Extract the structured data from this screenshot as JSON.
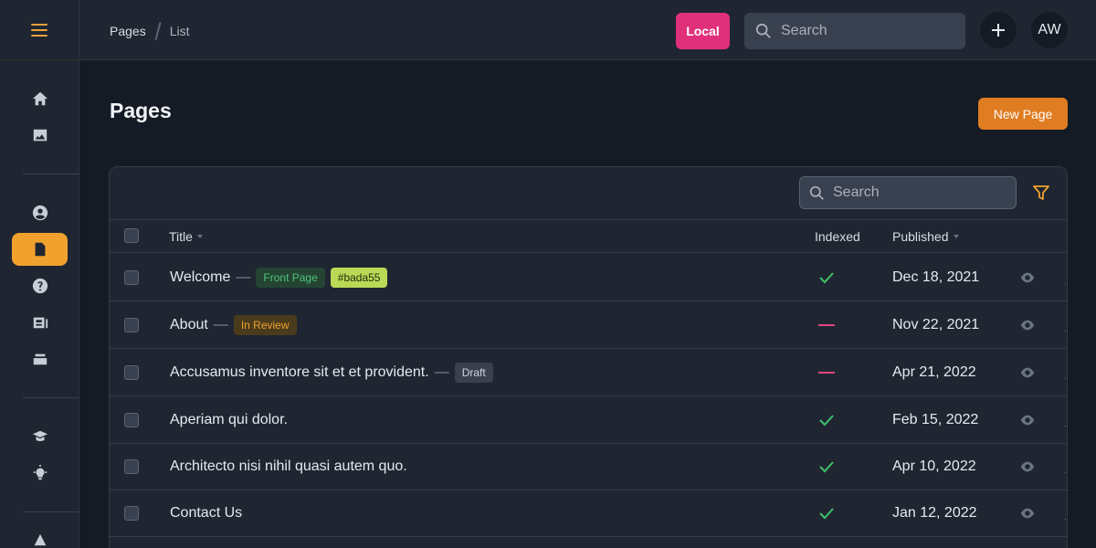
{
  "topbar": {
    "breadcrumb": [
      "Pages",
      "List"
    ],
    "env_badge": "Local",
    "search_placeholder": "Search",
    "avatar_initials": "AW"
  },
  "page": {
    "title": "Pages",
    "new_button": "New Page"
  },
  "table": {
    "search_placeholder": "Search",
    "columns": {
      "title": "Title",
      "indexed": "Indexed",
      "published": "Published"
    },
    "rows": [
      {
        "title": "Welcome",
        "tags": [
          {
            "label": "Front Page",
            "style": "green"
          },
          {
            "label": "#bada55",
            "style": "lime"
          }
        ],
        "indexed": true,
        "published": "Dec 18, 2021"
      },
      {
        "title": "About",
        "tags": [
          {
            "label": "In Review",
            "style": "amber"
          }
        ],
        "indexed": false,
        "published": "Nov 22, 2021"
      },
      {
        "title": "Accusamus inventore sit et et provident.",
        "tags": [
          {
            "label": "Draft",
            "style": "gray"
          }
        ],
        "indexed": false,
        "published": "Apr 21, 2022"
      },
      {
        "title": "Aperiam qui dolor.",
        "tags": [],
        "indexed": true,
        "published": "Feb 15, 2022"
      },
      {
        "title": "Architecto nisi nihil quasi autem quo.",
        "tags": [],
        "indexed": true,
        "published": "Apr 10, 2022"
      },
      {
        "title": "Contact Us",
        "tags": [],
        "indexed": true,
        "published": "Jan 12, 2022"
      }
    ]
  },
  "sidebar": {
    "items": [
      {
        "name": "home-icon"
      },
      {
        "name": "image-icon"
      },
      {
        "name": "user-circle-icon"
      },
      {
        "name": "document-icon",
        "active": true
      },
      {
        "name": "help-icon"
      },
      {
        "name": "id-card-icon"
      },
      {
        "name": "stack-icon"
      },
      {
        "name": "graduation-cap-icon"
      },
      {
        "name": "lightbulb-icon"
      }
    ]
  },
  "colors": {
    "accent": "#f0a12e",
    "env_badge": "#e0307a",
    "primary_button": "#e07c22",
    "indexed_yes": "#3fbf6a",
    "indexed_no": "#e0457a"
  }
}
